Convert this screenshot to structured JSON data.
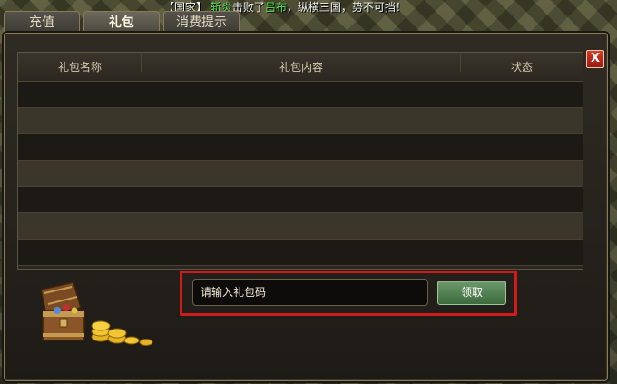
{
  "broadcast": {
    "prefix": "【国家】",
    "actor": "斩炎",
    "verb": "击败了",
    "target": "吕布",
    "suffix": "，纵横三国，势不可挡！"
  },
  "tabs": [
    {
      "label": "充值",
      "active": false
    },
    {
      "label": "礼包",
      "active": true
    },
    {
      "label": "消费提示",
      "active": false
    }
  ],
  "close_label": "X",
  "table": {
    "columns": [
      "礼包名称",
      "礼包内容",
      "状态"
    ],
    "rows": []
  },
  "redeem": {
    "input_value": "",
    "placeholder": "请输入礼包码",
    "button_label": "领取"
  },
  "colors": {
    "highlight_frame": "#d11a1a",
    "claim_button": "#4f7f4e",
    "close_button": "#c0281c",
    "broadcast_name": "#4fe24f"
  }
}
